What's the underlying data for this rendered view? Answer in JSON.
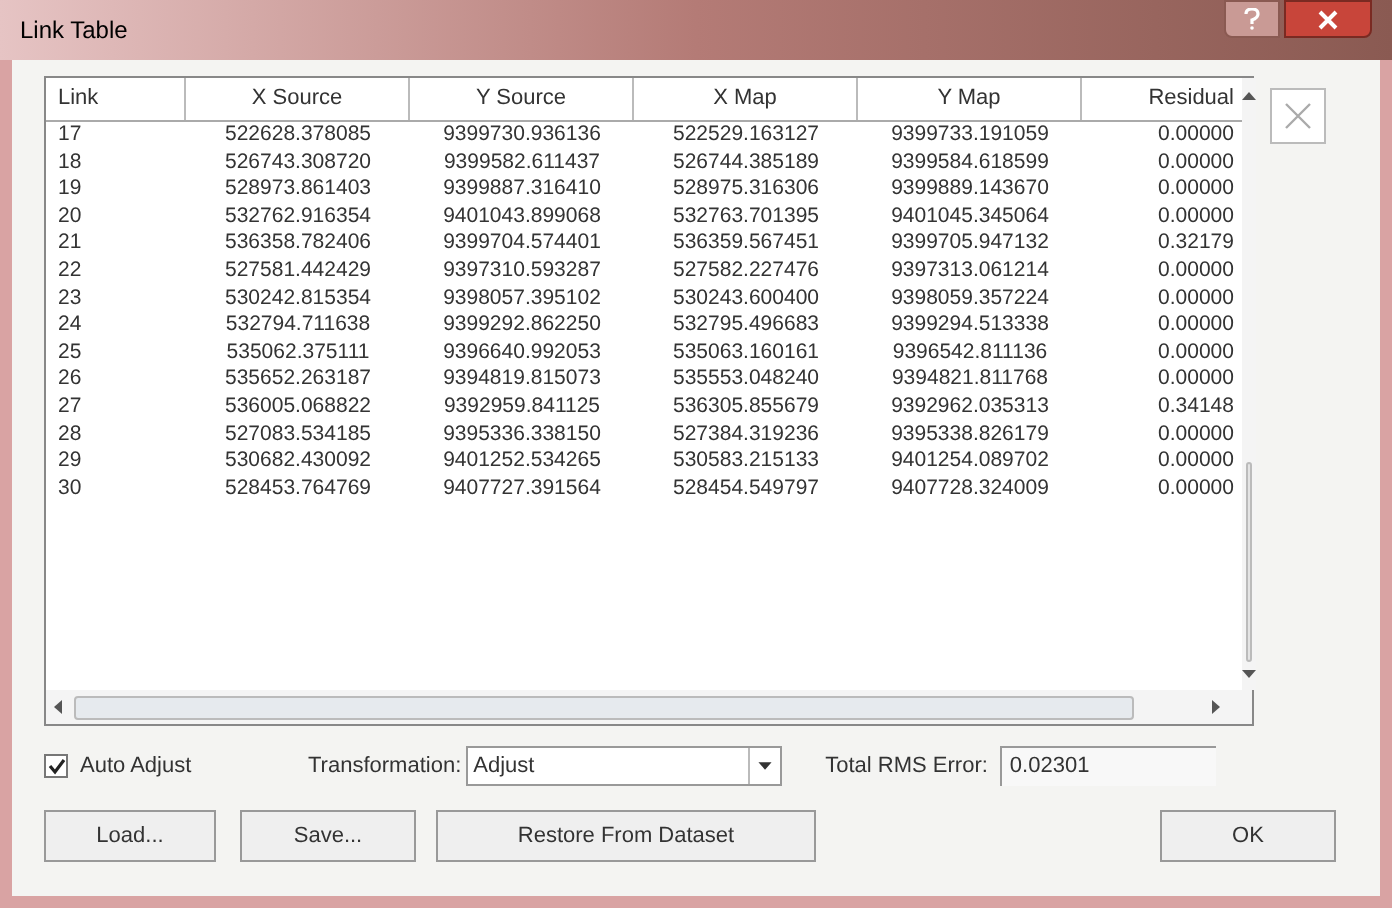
{
  "window": {
    "title": "Link Table"
  },
  "table": {
    "columns": [
      "Link",
      "X Source",
      "Y Source",
      "X Map",
      "Y Map",
      "Residual"
    ],
    "rows": [
      [
        "17",
        "522628.378085",
        "9399730.936136",
        "522529.163127",
        "9399733.191059",
        "0.00000"
      ],
      [
        "18",
        "526743.308720",
        "9399582.611437",
        "526744.385189",
        "9399584.618599",
        "0.00000"
      ],
      [
        "19",
        "528973.861403",
        "9399887.316410",
        "528975.316306",
        "9399889.143670",
        "0.00000"
      ],
      [
        "20",
        "532762.916354",
        "9401043.899068",
        "532763.701395",
        "9401045.345064",
        "0.00000"
      ],
      [
        "21",
        "536358.782406",
        "9399704.574401",
        "536359.567451",
        "9399705.947132",
        "0.32179"
      ],
      [
        "22",
        "527581.442429",
        "9397310.593287",
        "527582.227476",
        "9397313.061214",
        "0.00000"
      ],
      [
        "23",
        "530242.815354",
        "9398057.395102",
        "530243.600400",
        "9398059.357224",
        "0.00000"
      ],
      [
        "24",
        "532794.711638",
        "9399292.862250",
        "532795.496683",
        "9399294.513338",
        "0.00000"
      ],
      [
        "25",
        "535062.375111",
        "9396640.992053",
        "535063.160161",
        "9396542.811136",
        "0.00000"
      ],
      [
        "26",
        "535652.263187",
        "9394819.815073",
        "535553.048240",
        "9394821.811768",
        "0.00000"
      ],
      [
        "27",
        "536005.068822",
        "9392959.841125",
        "536305.855679",
        "9392962.035313",
        "0.34148"
      ],
      [
        "28",
        "527083.534185",
        "9395336.338150",
        "527384.319236",
        "9395338.826179",
        "0.00000"
      ],
      [
        "29",
        "530682.430092",
        "9401252.534265",
        "530583.215133",
        "9401254.089702",
        "0.00000"
      ],
      [
        "30",
        "528453.764769",
        "9407727.391564",
        "528454.549797",
        "9407728.324009",
        "0.00000"
      ]
    ]
  },
  "auto_adjust": {
    "label": "Auto Adjust",
    "checked": true
  },
  "transformation": {
    "label": "Transformation:",
    "value": "Adjust"
  },
  "rms": {
    "label": "Total RMS Error:",
    "value": "0.02301"
  },
  "buttons": [
    "Load...",
    "Save...",
    "Restore From Dataset",
    "OK"
  ]
}
